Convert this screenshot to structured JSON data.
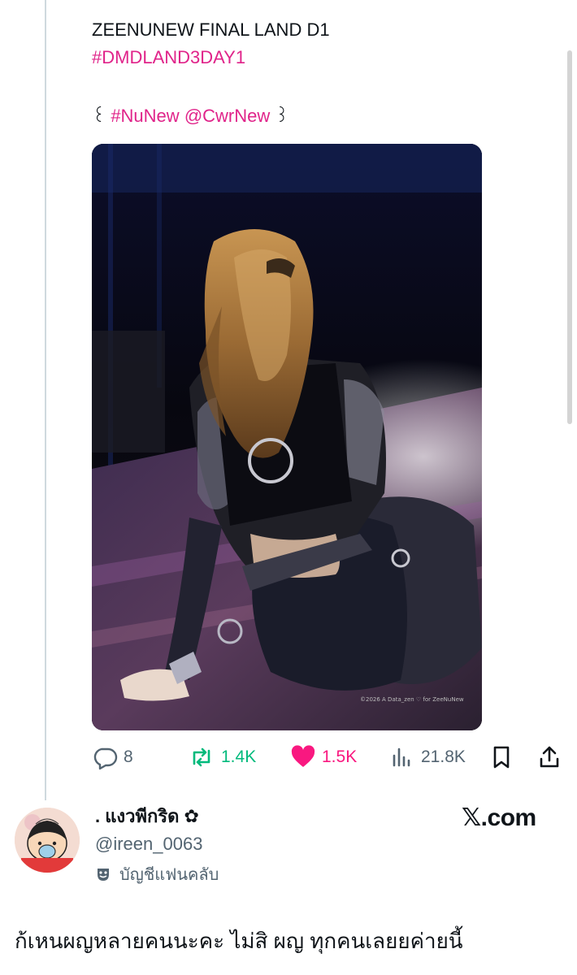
{
  "post": {
    "title": "ZEENUNEW FINAL LAND D1",
    "hashtag": "#DMDLAND3DAY1",
    "tag_open": "꒰ ",
    "tag_hashtag": "#NuNew",
    "tag_mention": "@CwrNew",
    "tag_close": " ꒱",
    "photo_watermark": "©2026  A  Data_zen ♡ for ZeeNuNew"
  },
  "actions": {
    "replies": "8",
    "reposts": "1.4K",
    "likes": "1.5K",
    "views": "21.8K",
    "reply_icon": "speech-bubble-icon",
    "repost_icon": "repost-arrows-icon",
    "like_icon": "heart-filled-icon",
    "views_icon": "bar-chart-icon",
    "bookmark_icon": "bookmark-icon",
    "share_icon": "share-upload-icon",
    "repost_color": "#00ba7c",
    "like_color": "#f91880"
  },
  "quoter": {
    "display_name": ". แงวพีกริด ✿",
    "handle": "@ireen_0063",
    "badge_label": "บัญชีแฟนคลับ",
    "badge_icon": "theater-mask-icon",
    "site_label": "𝕏.com",
    "caption": "ก้เหนผญหลายคนนะคะ ไม่สิ ผญ ทุกคนเลยยค่ายนี้"
  },
  "colors": {
    "accent_pink": "#e0248a",
    "text": "#0f1419",
    "muted": "#536471"
  }
}
